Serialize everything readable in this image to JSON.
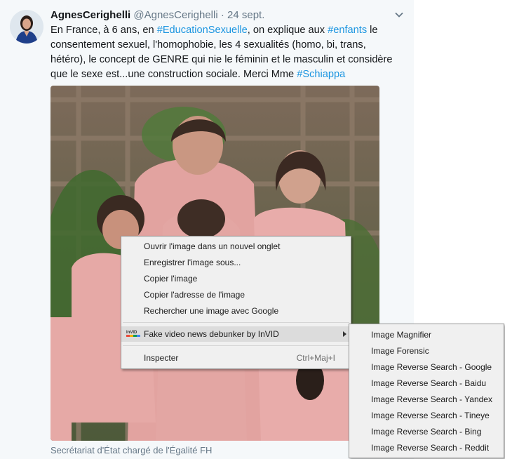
{
  "tweet": {
    "name": "AgnesCerighelli",
    "handle": "@AgnesCerighelli",
    "separator": "·",
    "date": "24 sept.",
    "text": {
      "part1": "En France, à 6 ans, en ",
      "tag1": "#EducationSexuelle",
      "part2": ", on explique aux ",
      "tag2": "#enfants",
      "part3": " le consentement sexuel, l'homophobie, les 4 sexualités (homo, bi, trans, hétéro), le concept de GENRE qui nie le féminin et le masculin et considère que le sexe est...une construction sociale. Merci Mme ",
      "tag3": "#Schiappa"
    },
    "caption": "Secrétariat d'État chargé de l'Égalité FH"
  },
  "context_menu": {
    "items": [
      {
        "label": "Ouvrir l'image dans un nouvel onglet"
      },
      {
        "label": "Enregistrer l'image sous..."
      },
      {
        "label": "Copier l'image"
      },
      {
        "label": "Copier l'adresse de l'image"
      },
      {
        "label": "Rechercher une image avec Google"
      },
      {
        "label": "Fake video news debunker by InVID",
        "icon_text": "InVID",
        "highlighted": true
      },
      {
        "label": "Inspecter",
        "shortcut": "Ctrl+Maj+I"
      }
    ]
  },
  "submenu": {
    "items": [
      {
        "label": "Image Magnifier"
      },
      {
        "label": "Image Forensic"
      },
      {
        "label": "Image Reverse Search - Google"
      },
      {
        "label": "Image Reverse Search - Baidu"
      },
      {
        "label": "Image Reverse Search - Yandex"
      },
      {
        "label": "Image Reverse Search - Tineye"
      },
      {
        "label": "Image Reverse Search - Bing"
      },
      {
        "label": "Image Reverse Search - Reddit"
      }
    ]
  },
  "colors": {
    "hashtag": "#1b95e0",
    "name": "#14171a",
    "meta": "#657786",
    "menu_bg": "#f0f0f0",
    "menu_highlight": "#dcdcdc"
  }
}
